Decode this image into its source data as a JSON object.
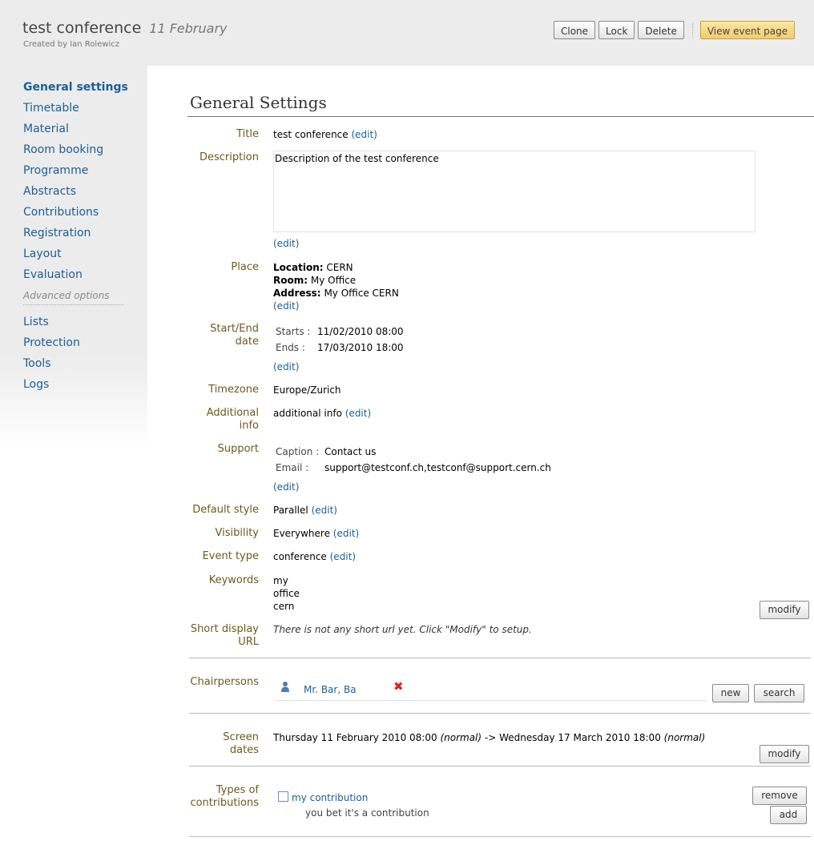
{
  "header": {
    "title": "test conference",
    "date": "11 February",
    "created_by": "Created by Ian Rolewicz",
    "buttons": {
      "clone": "Clone",
      "lock": "Lock",
      "delete": "Delete",
      "view_event": "View event page"
    }
  },
  "sidebar": {
    "items": [
      {
        "label": "General settings"
      },
      {
        "label": "Timetable"
      },
      {
        "label": "Material"
      },
      {
        "label": "Room booking"
      },
      {
        "label": "Programme"
      },
      {
        "label": "Abstracts"
      },
      {
        "label": "Contributions"
      },
      {
        "label": "Registration"
      },
      {
        "label": "Layout"
      },
      {
        "label": "Evaluation"
      }
    ],
    "advanced_label": "Advanced options",
    "advanced_items": [
      {
        "label": "Lists"
      },
      {
        "label": "Protection"
      },
      {
        "label": "Tools"
      },
      {
        "label": "Logs"
      }
    ]
  },
  "main": {
    "heading": "General Settings",
    "edit_link": "(edit)",
    "title": {
      "label": "Title",
      "value": "test conference"
    },
    "description": {
      "label": "Description",
      "value": "Description of the test conference"
    },
    "place": {
      "label": "Place",
      "location_key": "Location:",
      "location": "CERN",
      "room_key": "Room:",
      "room": "My Office",
      "address_key": "Address:",
      "address": "My Office CERN"
    },
    "dates": {
      "label_line1": "Start/End",
      "label_line2": "date",
      "starts_key": "Starts :",
      "starts": "11/02/2010 08:00",
      "ends_key": "Ends :",
      "ends": "17/03/2010 18:00"
    },
    "timezone": {
      "label": "Timezone",
      "value": "Europe/Zurich"
    },
    "additional_info": {
      "label_line1": "Additional",
      "label_line2": "info",
      "value": "additional info"
    },
    "support": {
      "label": "Support",
      "caption_key": "Caption :",
      "caption": "Contact us",
      "email_key": "Email :",
      "email": "support@testconf.ch,testconf@support.cern.ch"
    },
    "default_style": {
      "label": "Default style",
      "value": "Parallel"
    },
    "visibility": {
      "label": "Visibility",
      "value": "Everywhere"
    },
    "event_type": {
      "label": "Event type",
      "value": "conference"
    },
    "keywords": {
      "label": "Keywords",
      "values": [
        "my",
        "office",
        "cern"
      ],
      "modify": "modify"
    },
    "short_url": {
      "label_line1": "Short display",
      "label_line2": "URL",
      "value": "There is not any short url yet. Click \"Modify\" to setup."
    },
    "chairpersons": {
      "label": "Chairpersons",
      "person": "Mr. Bar, Ba",
      "new": "new",
      "search": "search"
    },
    "screen_dates": {
      "label_line1": "Screen",
      "label_line2": "dates",
      "start": "Thursday 11 February 2010 08:00",
      "start_mode": "(normal)",
      "arrow": "->",
      "end": "Wednesday 17 March 2010 18:00",
      "end_mode": "(normal)",
      "modify": "modify"
    },
    "contribution_types": {
      "label_line1": "Types of",
      "label_line2": "contributions",
      "name": "my contribution",
      "description": "you bet it's a contribution",
      "remove": "remove",
      "add": "add"
    }
  }
}
